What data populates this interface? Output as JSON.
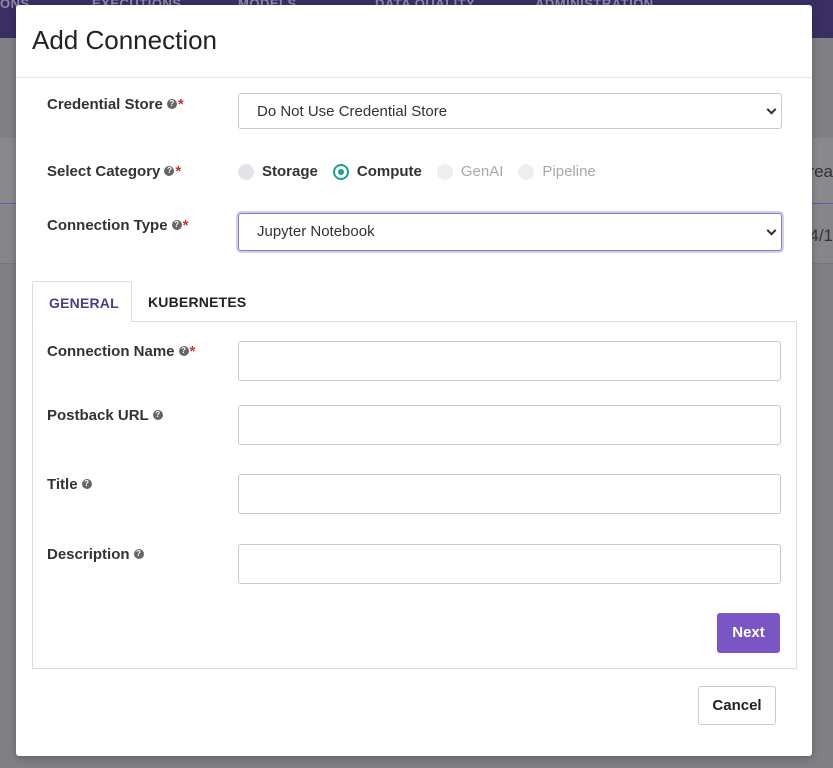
{
  "background": {
    "nav_items": [
      "ONS",
      "EXECUTIONS",
      "MODELS",
      "DATA QUALITY",
      "ADMINISTRATION"
    ],
    "right_text_1": "rea",
    "right_text_2": "4/1"
  },
  "modal": {
    "title": "Add Connection",
    "credential_store": {
      "label": "Credential Store",
      "help_icon": "question-circle-icon",
      "required_mark": "*",
      "value": "Do Not Use Credential Store"
    },
    "category": {
      "label": "Select Category",
      "help_icon": "question-circle-icon",
      "required_mark": "*",
      "options": [
        {
          "label": "Storage",
          "selected": false,
          "disabled": false
        },
        {
          "label": "Compute",
          "selected": true,
          "disabled": false
        },
        {
          "label": "GenAI",
          "selected": false,
          "disabled": true
        },
        {
          "label": "Pipeline",
          "selected": false,
          "disabled": true
        }
      ]
    },
    "connection_type": {
      "label": "Connection Type",
      "help_icon": "question-circle-icon",
      "required_mark": "*",
      "value": "Jupyter Notebook"
    },
    "tabs": [
      {
        "label": "GENERAL",
        "active": true
      },
      {
        "label": "KUBERNETES",
        "active": false
      }
    ],
    "fields": {
      "connection_name": {
        "label": "Connection Name",
        "required_mark": "*",
        "value": ""
      },
      "postback_url": {
        "label": "Postback URL",
        "value": ""
      },
      "title": {
        "label": "Title",
        "value": ""
      },
      "description": {
        "label": "Description",
        "value": ""
      }
    },
    "next_label": "Next",
    "cancel_label": "Cancel"
  },
  "colors": {
    "accent": "#7a56c4",
    "radio_selected": "#17a28c",
    "required": "#d0302f",
    "tab_active_text": "#4d3c8c"
  }
}
